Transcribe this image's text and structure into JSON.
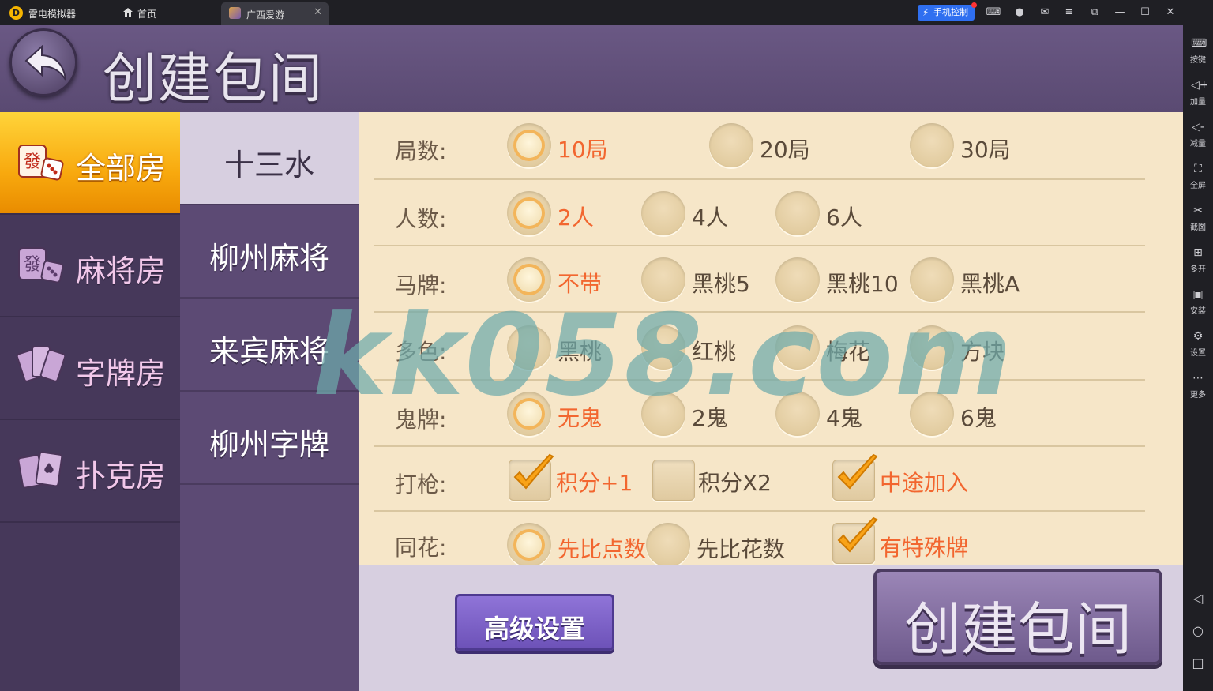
{
  "emulator": {
    "app_name": "雷电模拟器",
    "tabs": [
      {
        "label": "首页"
      },
      {
        "label": "广西爱游"
      }
    ],
    "phone_control_label": "手机控制",
    "sidebar": [
      {
        "label": "按键",
        "icon": "keyboard-icon"
      },
      {
        "label": "加量",
        "icon": "volume-up-icon"
      },
      {
        "label": "减量",
        "icon": "volume-down-icon"
      },
      {
        "label": "全屏",
        "icon": "fullscreen-icon"
      },
      {
        "label": "截图",
        "icon": "scissors-icon"
      },
      {
        "label": "多开",
        "icon": "multi-instance-icon"
      },
      {
        "label": "安装",
        "icon": "apk-icon"
      },
      {
        "label": "设置",
        "icon": "gear-icon"
      },
      {
        "label": "更多",
        "icon": "more-icon"
      }
    ]
  },
  "game": {
    "title": "创建包间",
    "categories": [
      {
        "label": "全部房",
        "active": true
      },
      {
        "label": "麻将房",
        "active": false
      },
      {
        "label": "字牌房",
        "active": false
      },
      {
        "label": "扑克房",
        "active": false
      }
    ],
    "games": [
      {
        "label": "十三水",
        "active": true
      },
      {
        "label": "柳州麻将",
        "active": false
      },
      {
        "label": "来宾麻将",
        "active": false
      },
      {
        "label": "柳州字牌",
        "active": false
      }
    ],
    "options": [
      {
        "label": "局数:",
        "type": "radio",
        "choices": [
          "10局",
          "20局",
          "30局"
        ],
        "selected": [
          0
        ]
      },
      {
        "label": "人数:",
        "type": "radio",
        "choices": [
          "2人",
          "4人",
          "6人"
        ],
        "selected": [
          0
        ]
      },
      {
        "label": "马牌:",
        "type": "radio",
        "choices": [
          "不带",
          "黑桃5",
          "黑桃10",
          "黑桃A"
        ],
        "selected": [
          0
        ]
      },
      {
        "label": "多色:",
        "type": "check",
        "choices": [
          "黑桃",
          "红桃",
          "梅花",
          "方块"
        ],
        "selected": []
      },
      {
        "label": "鬼牌:",
        "type": "radio",
        "choices": [
          "无鬼",
          "2鬼",
          "4鬼",
          "6鬼"
        ],
        "selected": [
          0
        ]
      },
      {
        "label": "打枪:",
        "type": "check",
        "choices": [
          "积分+1",
          "积分X2",
          "中途加入"
        ],
        "selected": [
          0,
          2
        ]
      },
      {
        "label": "同花:",
        "type": "radio",
        "choices": [
          "先比点数",
          "先比花数",
          "有特殊牌"
        ],
        "selected": [
          0,
          2
        ]
      }
    ],
    "advanced_button": "高级设置",
    "create_button": "创建包间",
    "watermark": "kk058.com",
    "colors": {
      "selected_text": "#f2662f",
      "active_tab": "#f8a90e"
    }
  }
}
